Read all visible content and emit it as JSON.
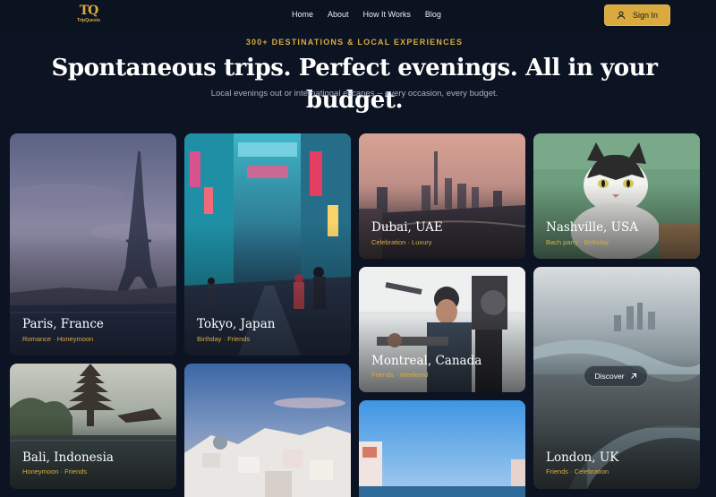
{
  "brand": {
    "logo_mark": "TQ",
    "logo_text": "TripQuests"
  },
  "nav": {
    "home": "Home",
    "about": "About",
    "how": "How It Works",
    "blog": "Blog"
  },
  "header": {
    "signin_label": "Sign In",
    "signin_icon": "user-icon"
  },
  "hero": {
    "eyebrow": "300+ DESTINATIONS & LOCAL EXPERIENCES",
    "headline": "Spontaneous trips. Perfect evenings. All in your budget.",
    "subline": "Local evenings out or international escapes -- every occasion, every budget."
  },
  "colors": {
    "accent": "#d9ab3f",
    "background": "#0c1322"
  },
  "destinations": [
    {
      "title": "Paris, France",
      "tags": "Romance · Honeymoon"
    },
    {
      "title": "Tokyo, Japan",
      "tags": "Birthday · Friends"
    },
    {
      "title": "Dubai, UAE",
      "tags": "Celebration · Luxury"
    },
    {
      "title": "Nashville, USA",
      "tags": "Bach party · Birthday"
    },
    {
      "title": "Montreal, Canada",
      "tags": "Friends · Weekend"
    },
    {
      "title": "London, UK",
      "tags": "Friends · Celebration",
      "button": "Discover",
      "button_icon": "arrow-up-right-icon"
    },
    {
      "title": "Bali, Indonesia",
      "tags": "Honeymoon · Friends"
    },
    {
      "title": "",
      "tags": ""
    },
    {
      "title": "",
      "tags": ""
    }
  ]
}
